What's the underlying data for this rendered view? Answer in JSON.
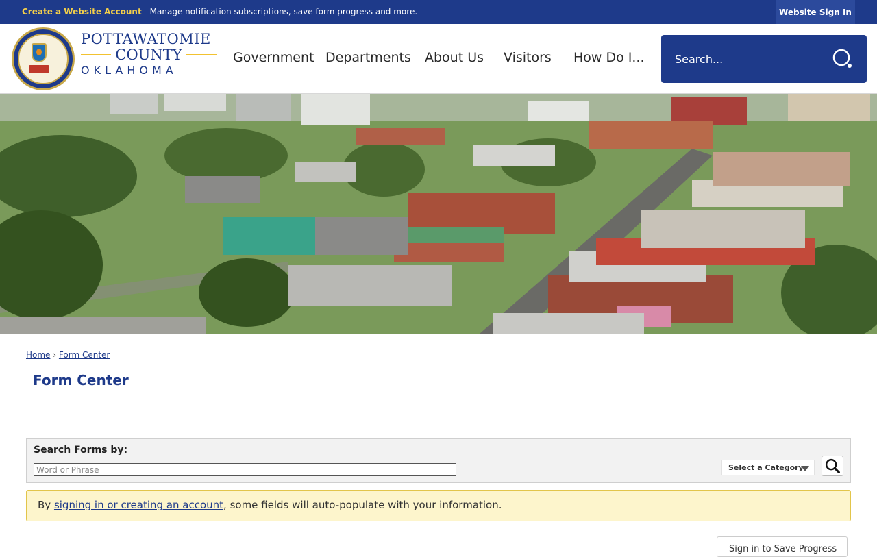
{
  "topbar": {
    "create_link": "Create a Website Account",
    "message": " - Manage notification subscriptions, save form progress and more.",
    "signin": "Website Sign In"
  },
  "header": {
    "brand_line1": "POTTAWATOMIE",
    "brand_line2": "COUNTY",
    "brand_line3": "OKLAHOMA",
    "nav": [
      "Government",
      "Departments",
      "About Us",
      "Visitors",
      "How Do I..."
    ],
    "search_placeholder": "Search..."
  },
  "breadcrumb": {
    "home": "Home",
    "separator": "›",
    "current": "Form Center"
  },
  "page_title": "Form Center",
  "form_search": {
    "label": "Search Forms by:",
    "placeholder": "Word or Phrase",
    "category": "Select a Category"
  },
  "notice": {
    "prefix": "By ",
    "link": "signing in or creating an account",
    "suffix": ", some fields will auto-populate with your information."
  },
  "save_button": "Sign in to Save Progress",
  "colors": {
    "primary": "#1e3a8a",
    "accent": "#f4cf4a",
    "notice_bg": "#fdf5cc"
  }
}
